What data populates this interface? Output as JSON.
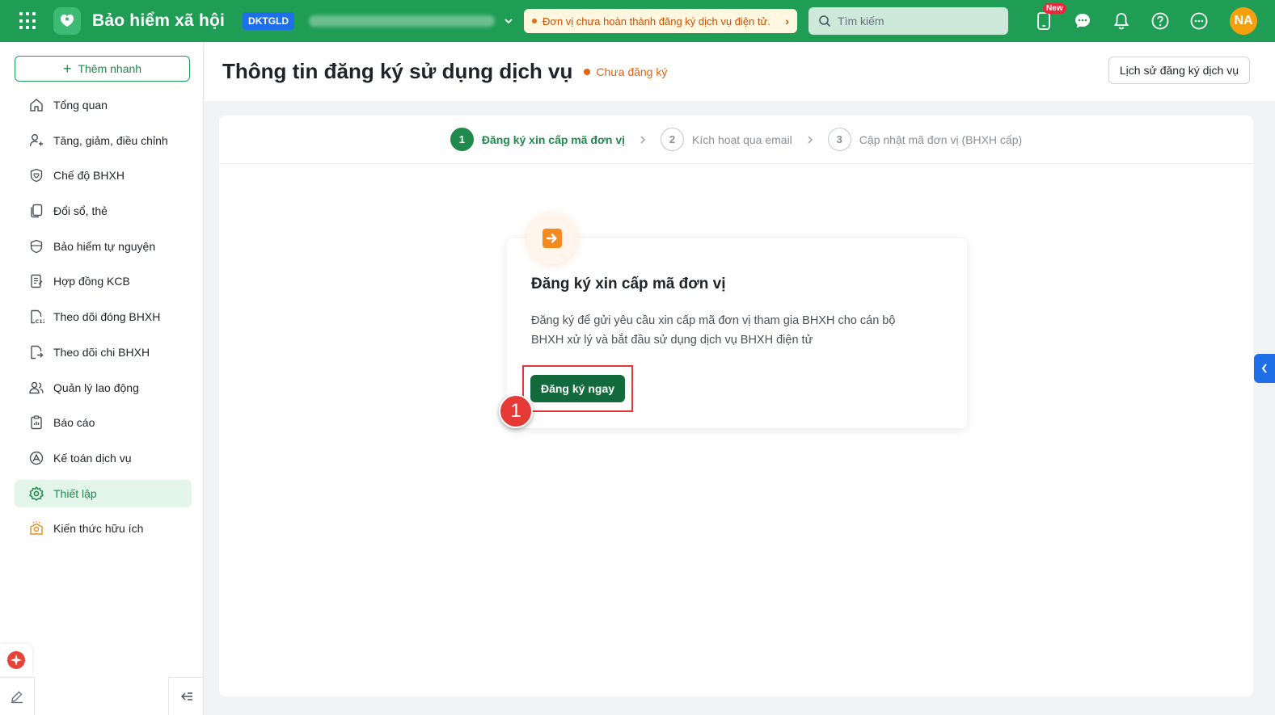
{
  "topbar": {
    "brand": "Bảo hiểm xã hội",
    "unit_code": "DKTGLD",
    "warning": "Đơn vị chưa hoàn thành đăng ký dịch vụ điện tử.",
    "search_placeholder": "Tìm kiếm",
    "new_badge": "New",
    "avatar_initials": "NA"
  },
  "sidebar": {
    "quick_add": "Thêm nhanh",
    "items": [
      {
        "label": "Tổng quan",
        "icon": "home-icon"
      },
      {
        "label": "Tăng, giảm, điều chỉnh",
        "icon": "user-adjust-icon"
      },
      {
        "label": "Chế độ BHXH",
        "icon": "shield-heart-icon"
      },
      {
        "label": "Đổi sổ, thẻ",
        "icon": "cards-icon"
      },
      {
        "label": "Bảo hiểm tự nguyện",
        "icon": "shield-icon"
      },
      {
        "label": "Hợp đồng KCB",
        "icon": "contract-icon"
      },
      {
        "label": "Theo dõi đóng BHXH",
        "icon": "c12-doc-icon"
      },
      {
        "label": "Theo dõi chi BHXH",
        "icon": "payout-doc-icon"
      },
      {
        "label": "Quản lý lao động",
        "icon": "people-icon"
      },
      {
        "label": "Báo cáo",
        "icon": "clipboard-icon"
      },
      {
        "label": "Kế toán dịch vụ",
        "icon": "accounting-icon"
      },
      {
        "label": "Thiết lập",
        "icon": "gear-icon",
        "active": true
      },
      {
        "label": "Kiến thức hữu ích",
        "icon": "knowledge-icon"
      }
    ]
  },
  "header": {
    "title": "Thông tin đăng ký sử dụng dịch vụ",
    "status": "Chưa đăng ký",
    "history_button": "Lịch sử đăng ký dịch vụ"
  },
  "stepper": {
    "steps": [
      {
        "num": "1",
        "label": "Đăng ký xin cấp mã đơn vị",
        "active": true
      },
      {
        "num": "2",
        "label": "Kích hoạt qua email"
      },
      {
        "num": "3",
        "label": "Cập nhật mã đơn vị (BHXH cấp)"
      }
    ]
  },
  "register": {
    "title": "Đăng ký xin cấp mã đơn vị",
    "description": "Đăng ký để gửi yêu cầu xin cấp mã đơn vị tham gia BHXH cho cán bộ BHXH xử lý và bắt đầu sử dụng dịch vụ BHXH điện tử",
    "button": "Đăng ký ngay"
  },
  "annotation": {
    "marker": "1"
  },
  "colors": {
    "brand_green": "#1f9d55",
    "button_green": "#136b3d",
    "warning_orange": "#e8620a",
    "accent_blue": "#1e6fe8",
    "annotation_red": "#e53935"
  }
}
